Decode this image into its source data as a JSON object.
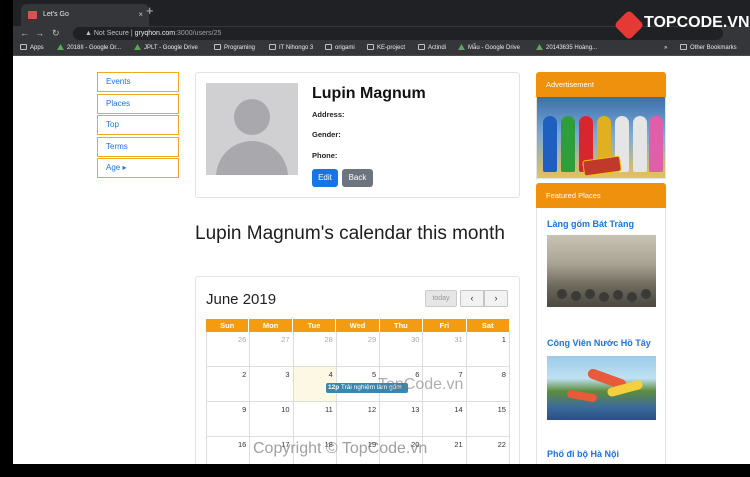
{
  "browser": {
    "tab_title": "Let's Go",
    "tab_close": "×",
    "new_tab": "+",
    "nav_back": "←",
    "nav_forward": "→",
    "nav_reload": "↻",
    "security_label": "Not Secure",
    "url_host": "gryqhon.com",
    "url_path": ":3000/users/25",
    "bookmarks": [
      "Apps",
      "2018II - Google Dr...",
      "JPLT - Google Drive",
      "Programing",
      "IT Nihongo 3",
      "origami",
      "KE-project",
      "Actindi",
      "Mẫu - Google Drive",
      "20143635 Hoàng...",
      "»",
      "Other Bookmarks"
    ]
  },
  "sidenav": {
    "items": [
      {
        "label": "Events"
      },
      {
        "label": "Places"
      },
      {
        "label": "Top"
      },
      {
        "label": "Terms"
      },
      {
        "label": "Age ▸"
      }
    ]
  },
  "profile": {
    "name": "Lupin Magnum",
    "address_label": "Address:",
    "gender_label": "Gender:",
    "phone_label": "Phone:",
    "edit_label": "Edit",
    "back_label": "Back"
  },
  "calendar": {
    "heading": "Lupin Magnum's calendar this month",
    "month": "June 2019",
    "today_label": "today",
    "prev_label": "‹",
    "next_label": "›",
    "weekdays": [
      "Sun",
      "Mon",
      "Tue",
      "Wed",
      "Thu",
      "Fri",
      "Sat"
    ],
    "weeks": [
      [
        "26",
        "27",
        "28",
        "29",
        "30",
        "31",
        "1"
      ],
      [
        "2",
        "3",
        "4",
        "5",
        "6",
        "7",
        "8"
      ],
      [
        "9",
        "10",
        "11",
        "12",
        "13",
        "14",
        "15"
      ],
      [
        "16",
        "17",
        "18",
        "19",
        "20",
        "21",
        "22"
      ]
    ],
    "event_time": "12p",
    "event_title": "Trải nghiệm làm gốm"
  },
  "sidebar": {
    "ad_header": "Advertisement",
    "featured_header": "Featured Places",
    "places": [
      {
        "name": "Làng gốm Bát Tràng"
      },
      {
        "name": "Công Viên Nước Hồ Tây"
      },
      {
        "name": "Phố đi bộ Hà Nội"
      }
    ]
  },
  "overlay": {
    "logo_text": "TOPCODE.VN",
    "watermark_center": "TopCode.vn",
    "watermark_bottom": "Copyright © TopCode.vn"
  },
  "colors": {
    "accent_orange": "#f0910e",
    "link_blue": "#1b74e4",
    "event_blue": "#3a87ad"
  }
}
